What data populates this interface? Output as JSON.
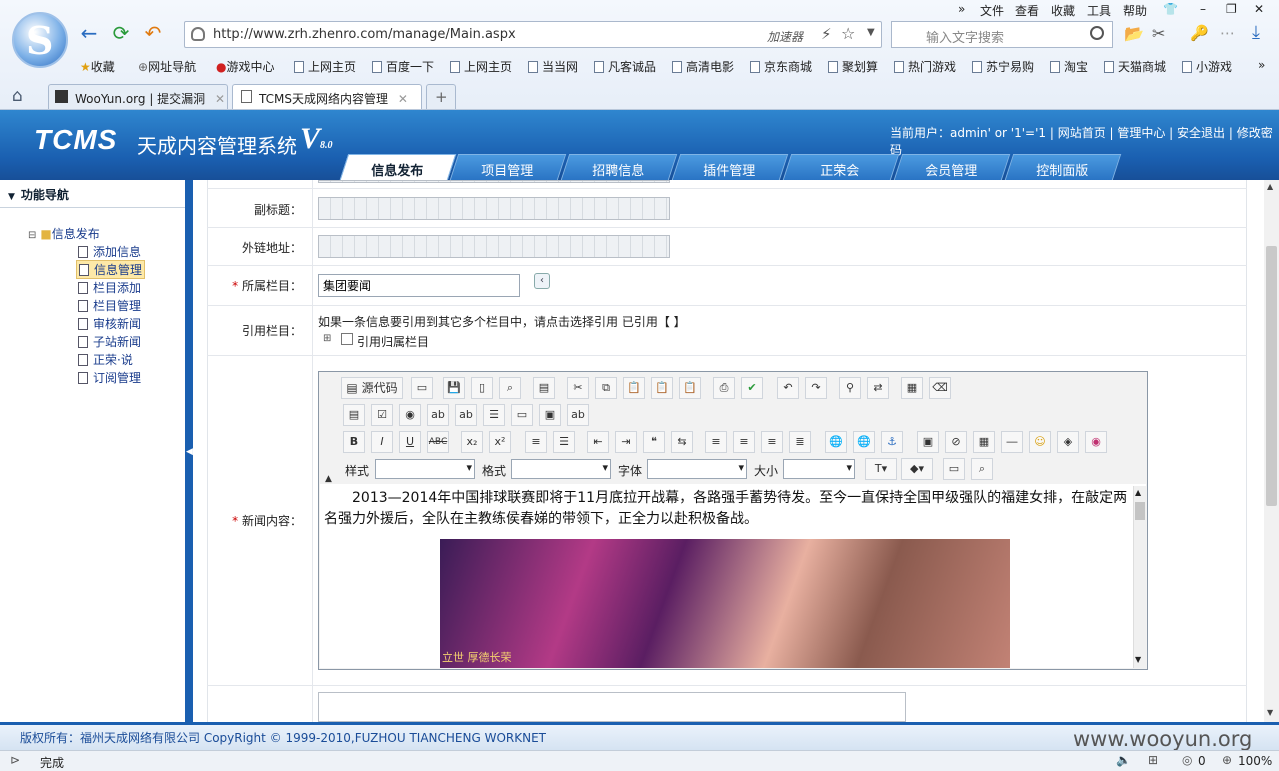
{
  "browser": {
    "menu": [
      "文件",
      "查看",
      "收藏",
      "工具",
      "帮助"
    ],
    "url": "http://www.zrh.zhenro.com/manage/Main.aspx",
    "accelerator": "加速器",
    "search_placeholder": "输入文字搜索",
    "bookmarks": [
      "收藏",
      "网址导航",
      "游戏中心",
      "上网主页",
      "百度一下",
      "上网主页",
      "当当网",
      "凡客诚品",
      "高清电影",
      "京东商城",
      "聚划算",
      "热门游戏",
      "苏宁易购",
      "淘宝",
      "天猫商城",
      "小游戏"
    ],
    "tabs": [
      "WooYun.org | 提交漏洞",
      "TCMS天成网络内容管理"
    ],
    "status": "完成",
    "zoom": "100%",
    "counter": "0"
  },
  "cms": {
    "logo": "TCMS",
    "name": "天成内容管理系统",
    "version": "V",
    "version_sub": "8.0",
    "user_info": "当前用户：admin' or '1'='1 | 网站首页 | 管理中心 | 安全退出 | 修改密码",
    "nav_tabs": [
      "信息发布",
      "项目管理",
      "招聘信息",
      "插件管理",
      "正荣会",
      "会员管理",
      "控制面版"
    ]
  },
  "sidebar": {
    "title": "功能导航",
    "root": "信息发布",
    "items": [
      "添加信息",
      "信息管理",
      "栏目添加",
      "栏目管理",
      "审核新闻",
      "子站新闻",
      "正荣·说",
      "订阅管理"
    ]
  },
  "form": {
    "subtitle_label": "副标题：",
    "link_label": "外链地址：",
    "column_label": "所属栏目：",
    "column_value": "集团要闻",
    "quote_label": "引用栏目：",
    "quote_hint": "如果一条信息要引用到其它多个栏目中，请点击选择引用  已引用【  】",
    "quote_check": "引用归属栏目",
    "content_label": "新闻内容：",
    "required_mark": "*",
    "editor": {
      "source_btn": "源代码",
      "style_label": "样式",
      "format_label": "格式",
      "font_label": "字体",
      "size_label": "大小",
      "text": "2013—2014年中国排球联赛即将于11月底拉开战幕，各路强手蓄势待发。至今一直保持全国甲级强队的福建女排，在敲定两名强力外援后，全队在主教练侯春娣的带领下，正全力以赴积极备战。",
      "banner_text": "立世 厚德长荣"
    }
  },
  "footer": {
    "copyright": "版权所有：福州天成网络有限公司 CopyRight © 1999-2010,FUZHOU TIANCHENG WORKNET",
    "watermark": "www.wooyun.org"
  }
}
